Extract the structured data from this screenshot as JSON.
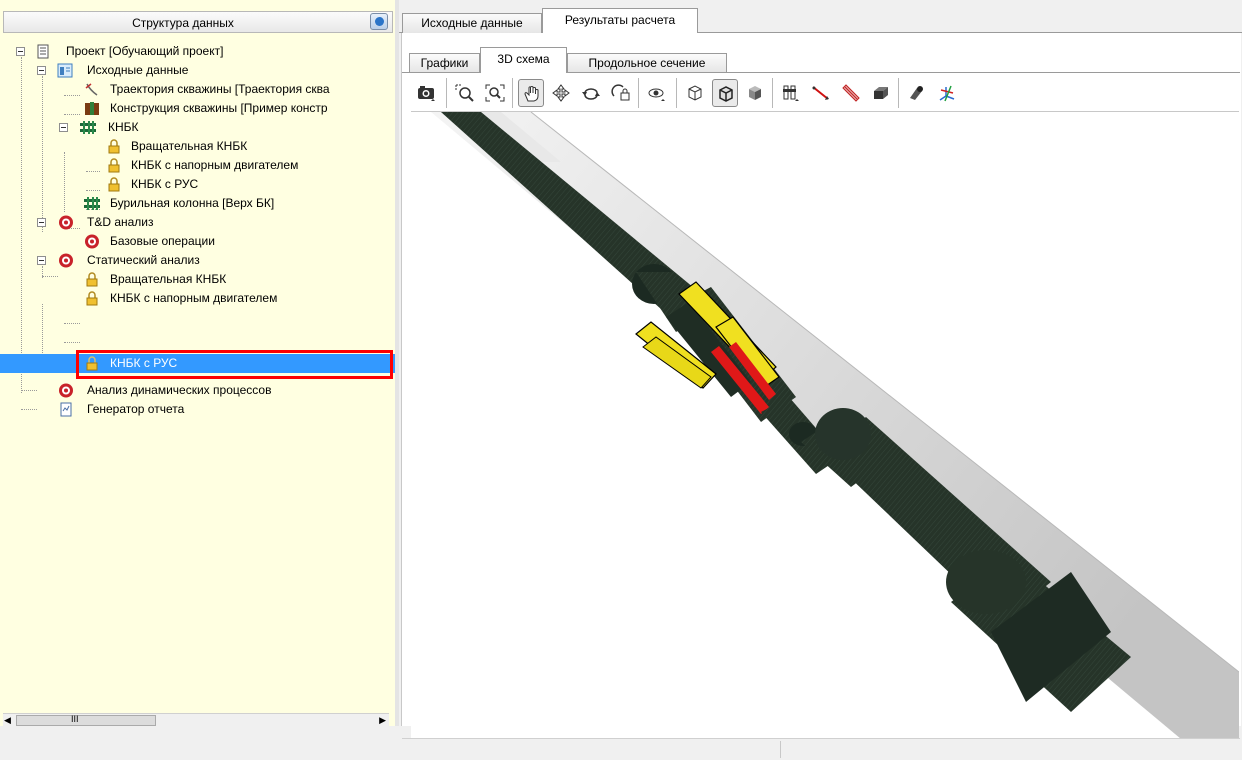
{
  "left_panel": {
    "header_title": "Структура данных",
    "tree": [
      {
        "label": "Проект [Обучающий проект]",
        "icon": "project-icon"
      },
      {
        "label": "Исходные данные",
        "icon": "input-data-icon"
      },
      {
        "label": "Траектория скважины [Траектория сква",
        "icon": "trajectory-icon"
      },
      {
        "label": "Конструкция скважины [Пример констр",
        "icon": "well-construction-icon"
      },
      {
        "label": "КНБК",
        "icon": "bha-icon"
      },
      {
        "label": "Вращательная КНБК",
        "icon": "lock-icon"
      },
      {
        "label": "КНБК с напорным двигателем",
        "icon": "lock-icon"
      },
      {
        "label": "КНБК с РУС",
        "icon": "lock-icon"
      },
      {
        "label": "Бурильная колонна [Верх БК]",
        "icon": "drill-string-icon"
      },
      {
        "label": "T&D анализ",
        "icon": "analysis-icon"
      },
      {
        "label": "Базовые операции",
        "icon": "analysis-icon"
      },
      {
        "label": "Статический анализ",
        "icon": "analysis-icon"
      },
      {
        "label": "Вращательная КНБК",
        "icon": "lock-icon"
      },
      {
        "label": "КНБК с напорным двигателем",
        "icon": "lock-icon"
      },
      {
        "label": "КНБК с РУС",
        "icon": "lock-icon",
        "selected": true
      },
      {
        "label": "Анализ динамических процессов",
        "icon": "analysis-icon"
      },
      {
        "label": "Генератор отчета",
        "icon": "report-icon"
      }
    ],
    "scroll_grip": "III"
  },
  "main_tabs": [
    "Исходные данные",
    "Результаты расчета"
  ],
  "sub_tabs": [
    "Графики",
    "3D схема",
    "Продольное сечение"
  ],
  "colors": {
    "selection": "#3399ff",
    "highlight_box": "#ff0000",
    "tree_bg": "#ffffe1"
  }
}
